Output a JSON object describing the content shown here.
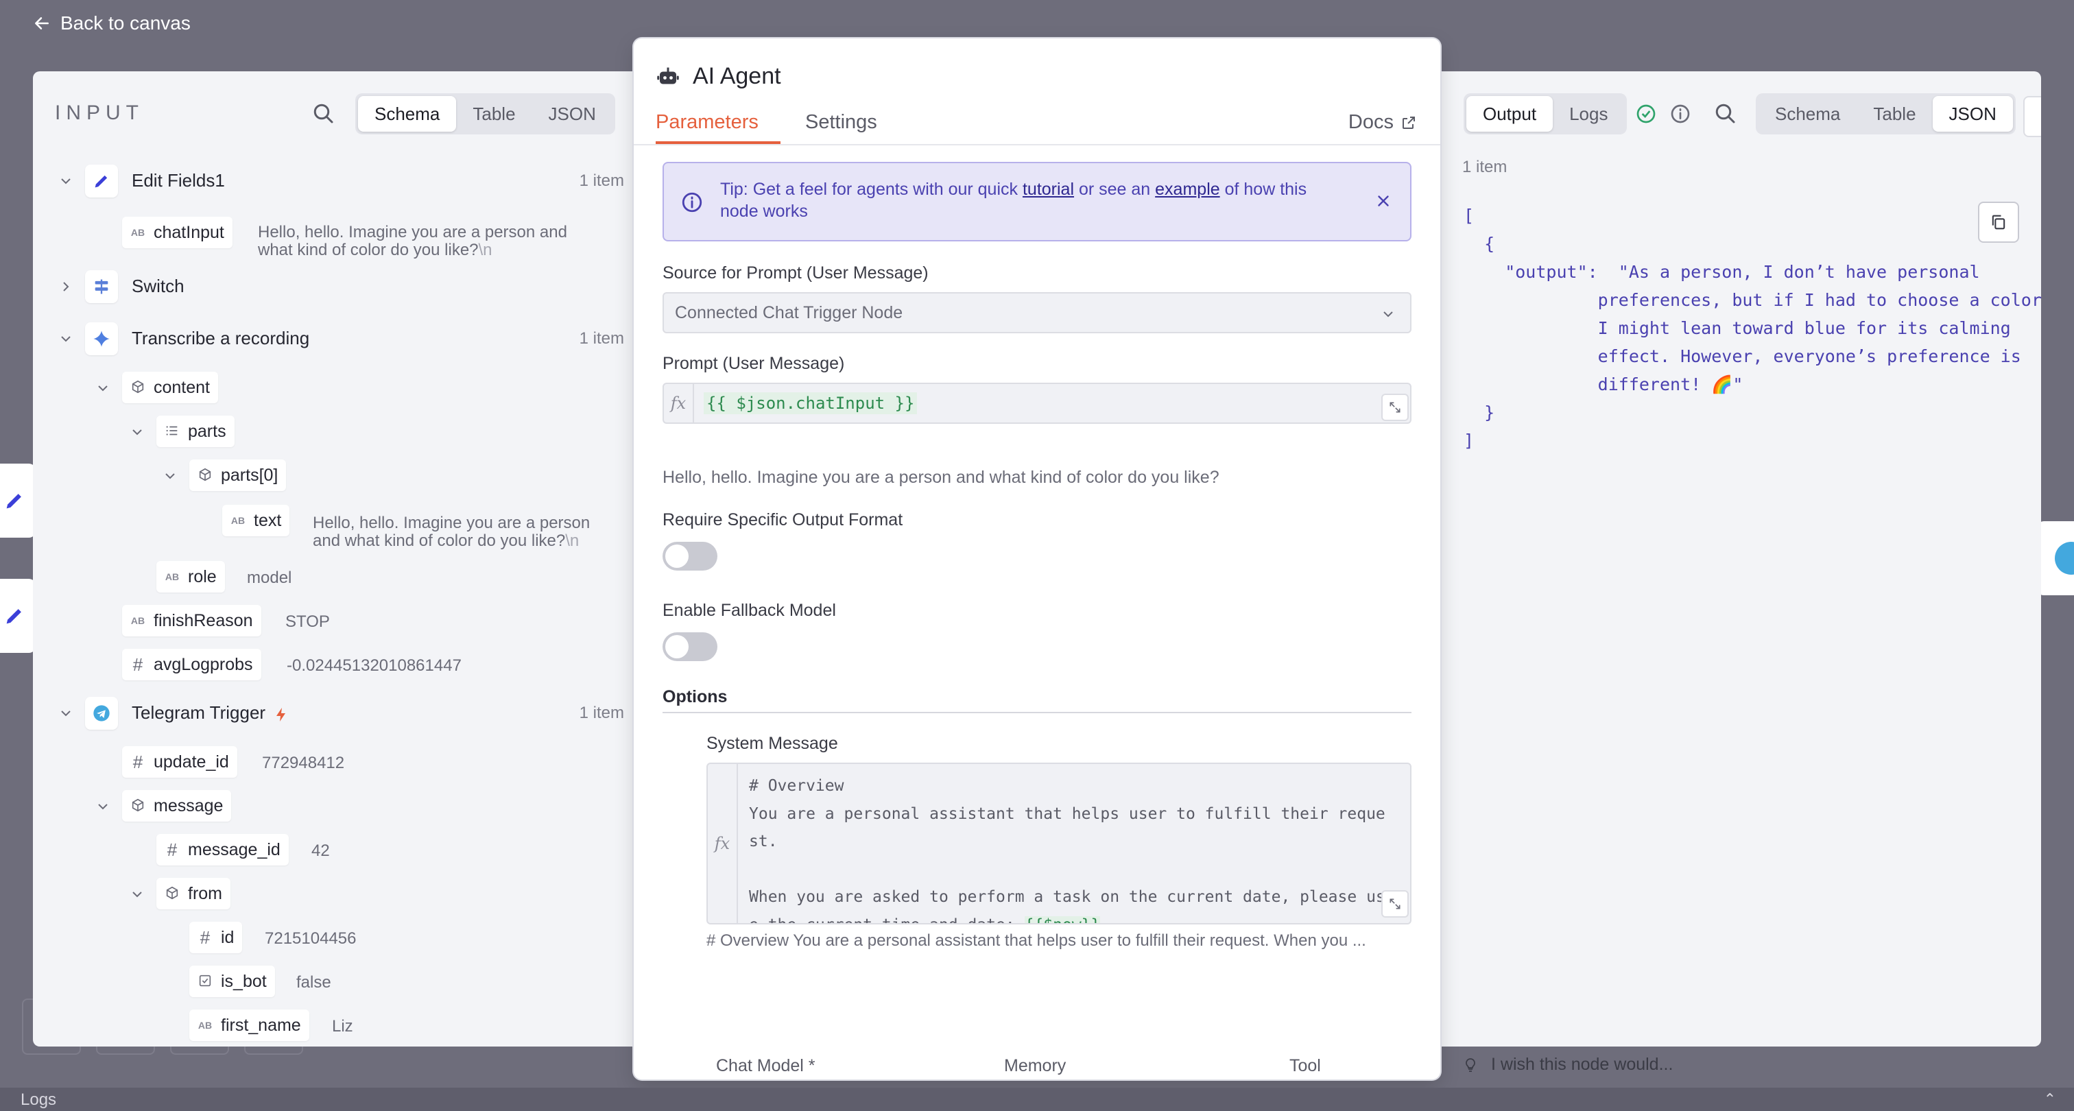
{
  "nav": {
    "back_label": "Back to canvas"
  },
  "input_panel": {
    "title": "INPUT",
    "view_tabs": [
      "Schema",
      "Table",
      "JSON"
    ],
    "active_view": "Schema",
    "nodes": {
      "edit_fields": {
        "name": "Edit Fields1",
        "count": "1 item"
      },
      "switch": {
        "name": "Switch"
      },
      "transcribe": {
        "name": "Transcribe a recording",
        "count": "1 item"
      },
      "telegram": {
        "name": "Telegram Trigger",
        "count": "1 item"
      }
    },
    "fields": {
      "chat_input": {
        "key": "chatInput",
        "type": "AB",
        "value_line1": "Hello, hello. Imagine you are a person and",
        "value_line2": "what kind of color do you like?",
        "newline": "\\n"
      },
      "content": {
        "key": "content"
      },
      "parts": {
        "key": "parts"
      },
      "parts0": {
        "key": "parts[0]"
      },
      "text": {
        "key": "text",
        "type": "AB",
        "value_line1": "Hello, hello. Imagine you are a person",
        "value_line2": "and what kind of color do you like?",
        "newline": "\\n"
      },
      "role": {
        "key": "role",
        "type": "AB",
        "value": "model"
      },
      "finish_reason": {
        "key": "finishReason",
        "type": "AB",
        "value": "STOP"
      },
      "avg_logprobs": {
        "key": "avgLogprobs",
        "type": "#",
        "value": "-0.02445132010861447"
      },
      "update_id": {
        "key": "update_id",
        "type": "#",
        "value": "772948412"
      },
      "message": {
        "key": "message"
      },
      "message_id": {
        "key": "message_id",
        "type": "#",
        "value": "42"
      },
      "from": {
        "key": "from"
      },
      "id": {
        "key": "id",
        "type": "#",
        "value": "7215104456"
      },
      "is_bot": {
        "key": "is_bot",
        "value": "false"
      },
      "first_name": {
        "key": "first_name",
        "type": "AB",
        "value": "Liz"
      }
    }
  },
  "modal": {
    "title": "AI Agent",
    "tabs": {
      "parameters": "Parameters",
      "settings": "Settings"
    },
    "docs_label": "Docs",
    "tip": {
      "prefix": "Tip: Get a feel for agents with our quick ",
      "link1": "tutorial",
      "middle": " or see an ",
      "link2": "example",
      "suffix": " of how this node works"
    },
    "source_label": "Source for Prompt (User Message)",
    "source_value": "Connected Chat Trigger Node",
    "prompt_label": "Prompt (User Message)",
    "fx": "fx",
    "prompt_expression": "{{ $json.chatInput }}",
    "prompt_preview": "Hello, hello. Imagine you are a person and what kind of color do you like?",
    "require_output_label": "Require Specific Output Format",
    "require_output_enabled": false,
    "fallback_label": "Enable Fallback Model",
    "fallback_enabled": false,
    "options_label": "Options",
    "system_message_label": "System Message",
    "system_message_lines": [
      "# Overview",
      "You are a personal assistant that helps user to fulfill their reque",
      "st.",
      "",
      "When you are asked to perform a task on the current date, please us",
      "e the current time and date: "
    ],
    "system_message_var": "{{$now}}",
    "system_message_preview": "# Overview You are a personal assistant that helps user to fulfill their request. When you ...",
    "sub_nodes": {
      "chat_model": "Chat Model *",
      "memory": "Memory",
      "tool": "Tool"
    },
    "plus": "+"
  },
  "output_panel": {
    "mode_tabs": [
      "Output",
      "Logs"
    ],
    "active_mode": "Output",
    "view_tabs": [
      "Schema",
      "Table",
      "JSON"
    ],
    "active_view": "JSON",
    "count": "1 item",
    "json_lines": [
      "[",
      "  {",
      "    \"output\":  \"As a person, I don’t have personal",
      "             preferences, but if I had to choose a color,",
      "             I might lean toward blue for its calming",
      "             effect. However, everyone’s preference is",
      "             different! 🌈\"",
      "  }",
      "]"
    ]
  },
  "feedback": {
    "label": "I wish this node would..."
  },
  "logs_bar": {
    "label": "Logs"
  },
  "colors": {
    "accent": "#e5603d",
    "tip_bg": "#e7e5f8",
    "json_text": "#4a41b0",
    "success": "#2fa36b"
  }
}
